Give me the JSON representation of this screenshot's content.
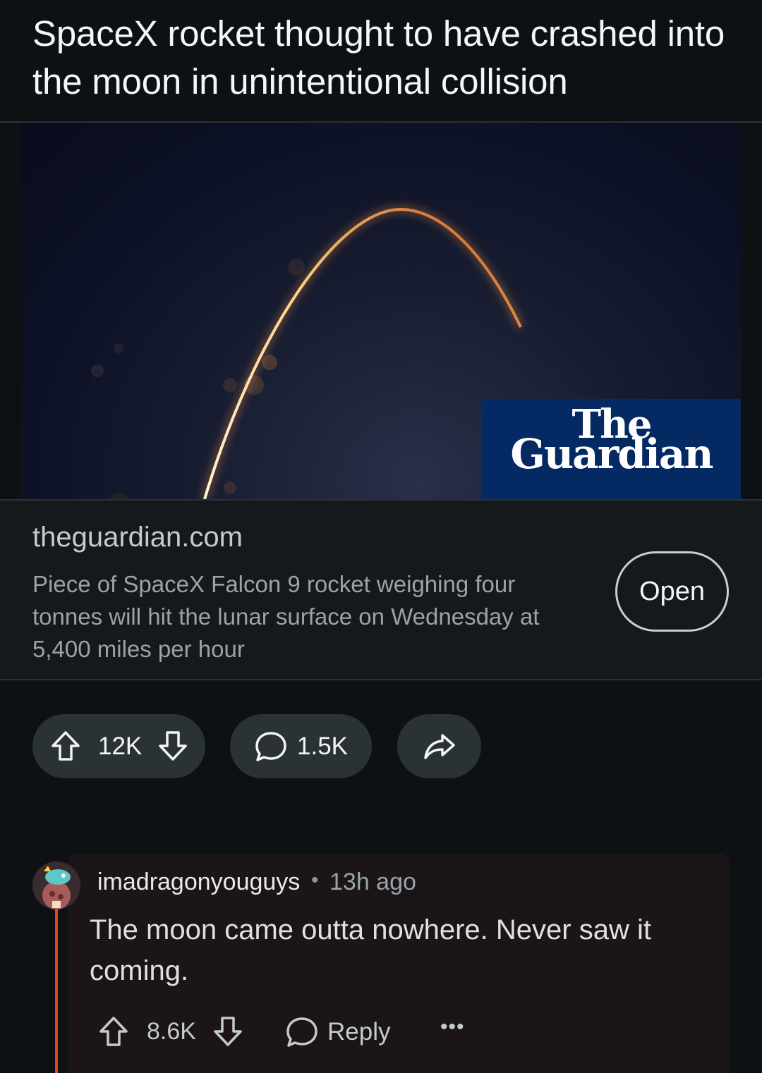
{
  "post": {
    "title": "SpaceX rocket thought to have crashed into the moon in unintentional collision"
  },
  "image": {
    "logo_line1": "The",
    "logo_line2": "Guardian",
    "logo_bg": "#052962"
  },
  "link": {
    "domain": "theguardian.com",
    "description": "Piece of SpaceX Falcon 9 rocket weighing four tonnes will hit the lunar surface on Wednesday at 5,400 miles per hour",
    "open_label": "Open"
  },
  "actions": {
    "upvotes": "12K",
    "comments": "1.5K",
    "upvote_icon": "arrow-up-icon",
    "downvote_icon": "arrow-down-icon",
    "comment_icon": "speech-bubble-icon",
    "share_icon": "share-arrow-icon"
  },
  "comment": {
    "username": "imadragonyouguys",
    "separator": "•",
    "time": "13h ago",
    "body": "The moon came outta nowhere. Never saw it coming.",
    "votes": "8.6K",
    "reply_label": "Reply",
    "more_label": "•••",
    "thread_color": "#e3461f"
  }
}
